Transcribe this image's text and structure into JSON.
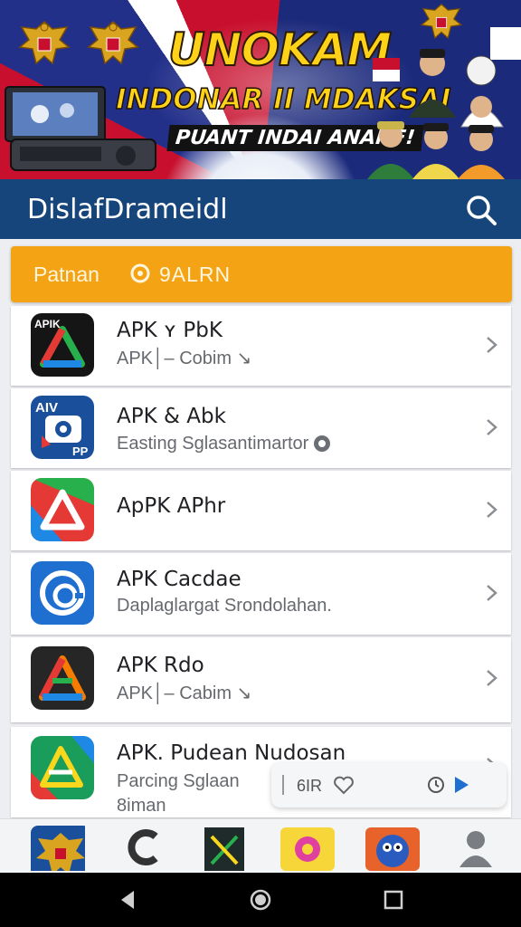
{
  "banner": {
    "title": "UNOKAM",
    "subtitle": "INDONAR II MDAKSAI",
    "tagline": "PUANT INDAI ANANF!"
  },
  "appbar": {
    "title": "DislafDrameidl",
    "search_icon": "search-icon"
  },
  "section": {
    "label": "Patnan",
    "tag": "9ALRN",
    "color": "#f3a314"
  },
  "apps": [
    {
      "title": "APK ʏ PbK",
      "subtitle": "APK│– Cobim ↘"
    },
    {
      "title": "APK & Abk",
      "subtitle": "Easting Sglasantimartor"
    },
    {
      "title": "ApPK APhr",
      "subtitle": ""
    },
    {
      "title": "APK Cacdae",
      "subtitle": "Daplaglargat Srondolahan."
    },
    {
      "title": "APK Rdo",
      "subtitle": "APK│– Cabim ↘"
    },
    {
      "title": "APK. Pudean Nudosan",
      "subtitle": "Parcing Sglaan",
      "subtitle2": "8iman"
    }
  ],
  "icon_labels": {
    "app2_top": "AIV",
    "app2_bottom": "PP",
    "app1_top": "APIK"
  },
  "toast": {
    "text": "6IR"
  },
  "bottom_nav": [
    "emblem-icon",
    "c-logo-icon",
    "dark-app-icon",
    "flower-app-icon",
    "mascot-app-icon",
    "profile-icon"
  ],
  "colors": {
    "appbar": "#15457a",
    "section": "#f3a314",
    "accent": "#1e6fd0"
  }
}
